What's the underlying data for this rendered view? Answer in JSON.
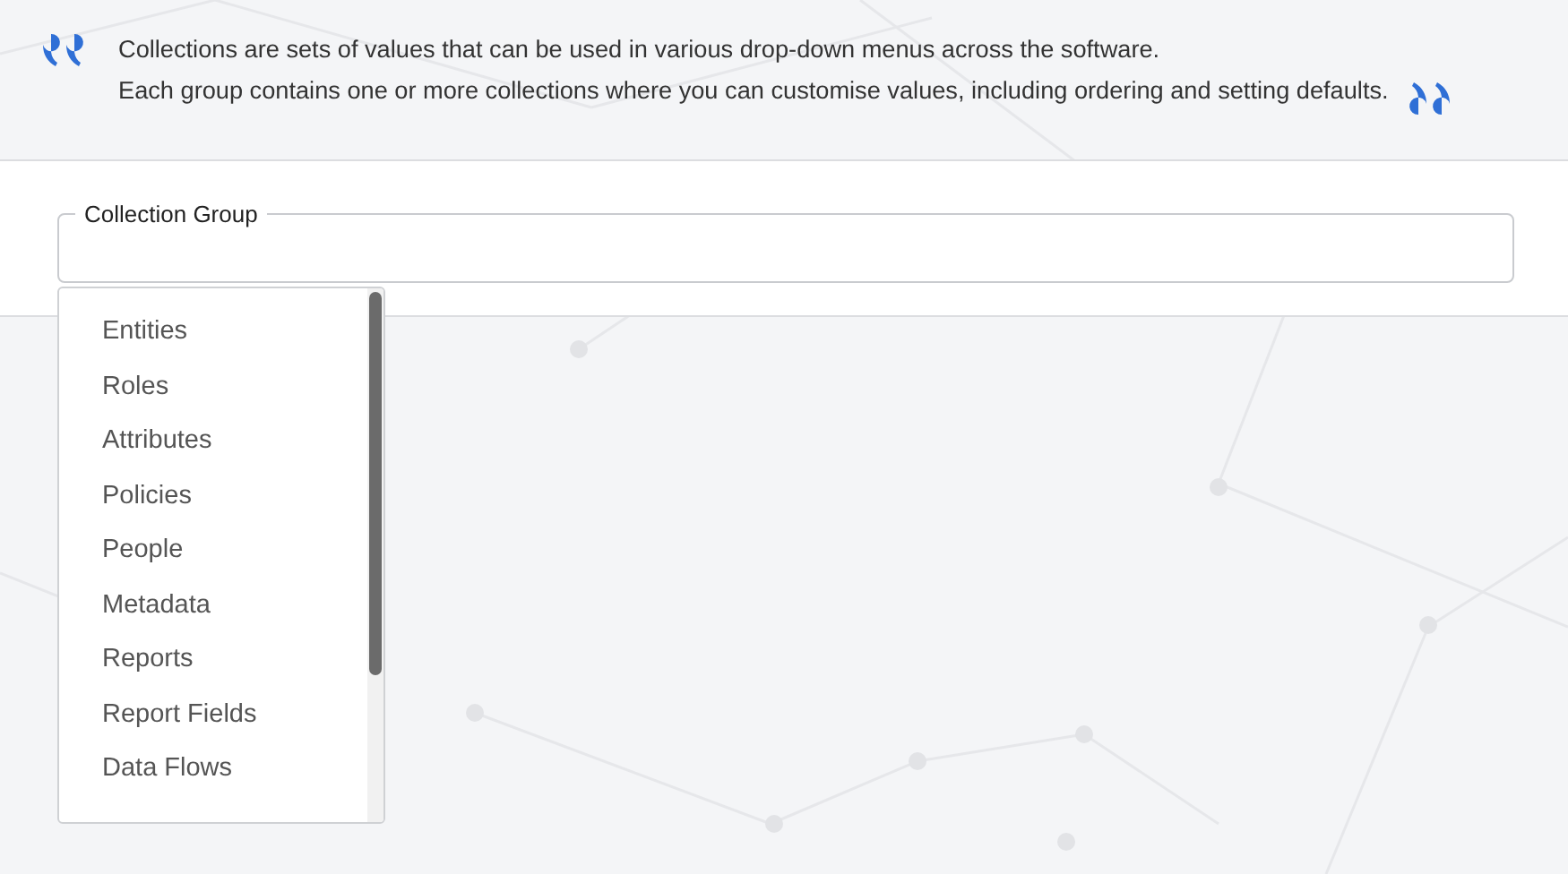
{
  "intro": {
    "lines": [
      "Collections are sets of values that can be used in various drop-down menus across the software.",
      "Each group contains one or more collections where you can customise values, including ordering and setting defaults."
    ]
  },
  "collection_group": {
    "label": "Collection Group",
    "options": [
      "Entities",
      "Roles",
      "Attributes",
      "Policies",
      "People",
      "Metadata",
      "Reports",
      "Report Fields",
      "Data Flows"
    ]
  }
}
